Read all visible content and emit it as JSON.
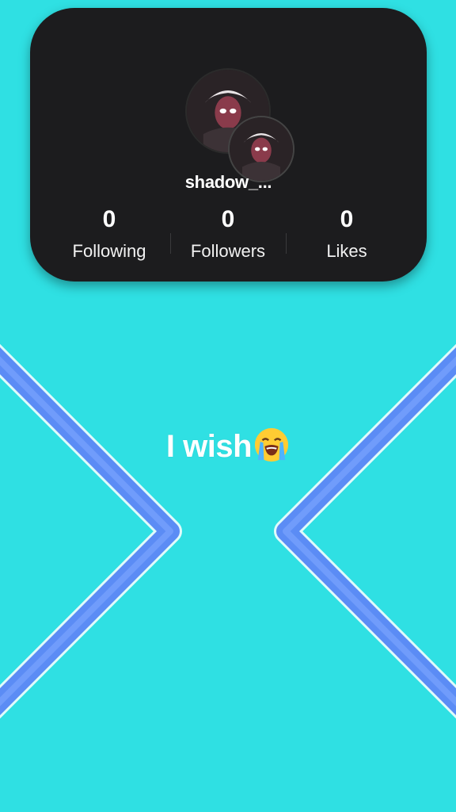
{
  "profile": {
    "username": "shadow_...",
    "stats": [
      {
        "count": "0",
        "label": "Following"
      },
      {
        "count": "0",
        "label": "Followers"
      },
      {
        "count": "0",
        "label": "Likes"
      }
    ]
  },
  "caption": {
    "text": "I wish",
    "emoji": "loudly-crying-face-icon"
  },
  "colors": {
    "background": "#2fe0e3",
    "card": "#1c1c1e",
    "chevron": "#5b8cf5",
    "text": "#ffffff"
  }
}
